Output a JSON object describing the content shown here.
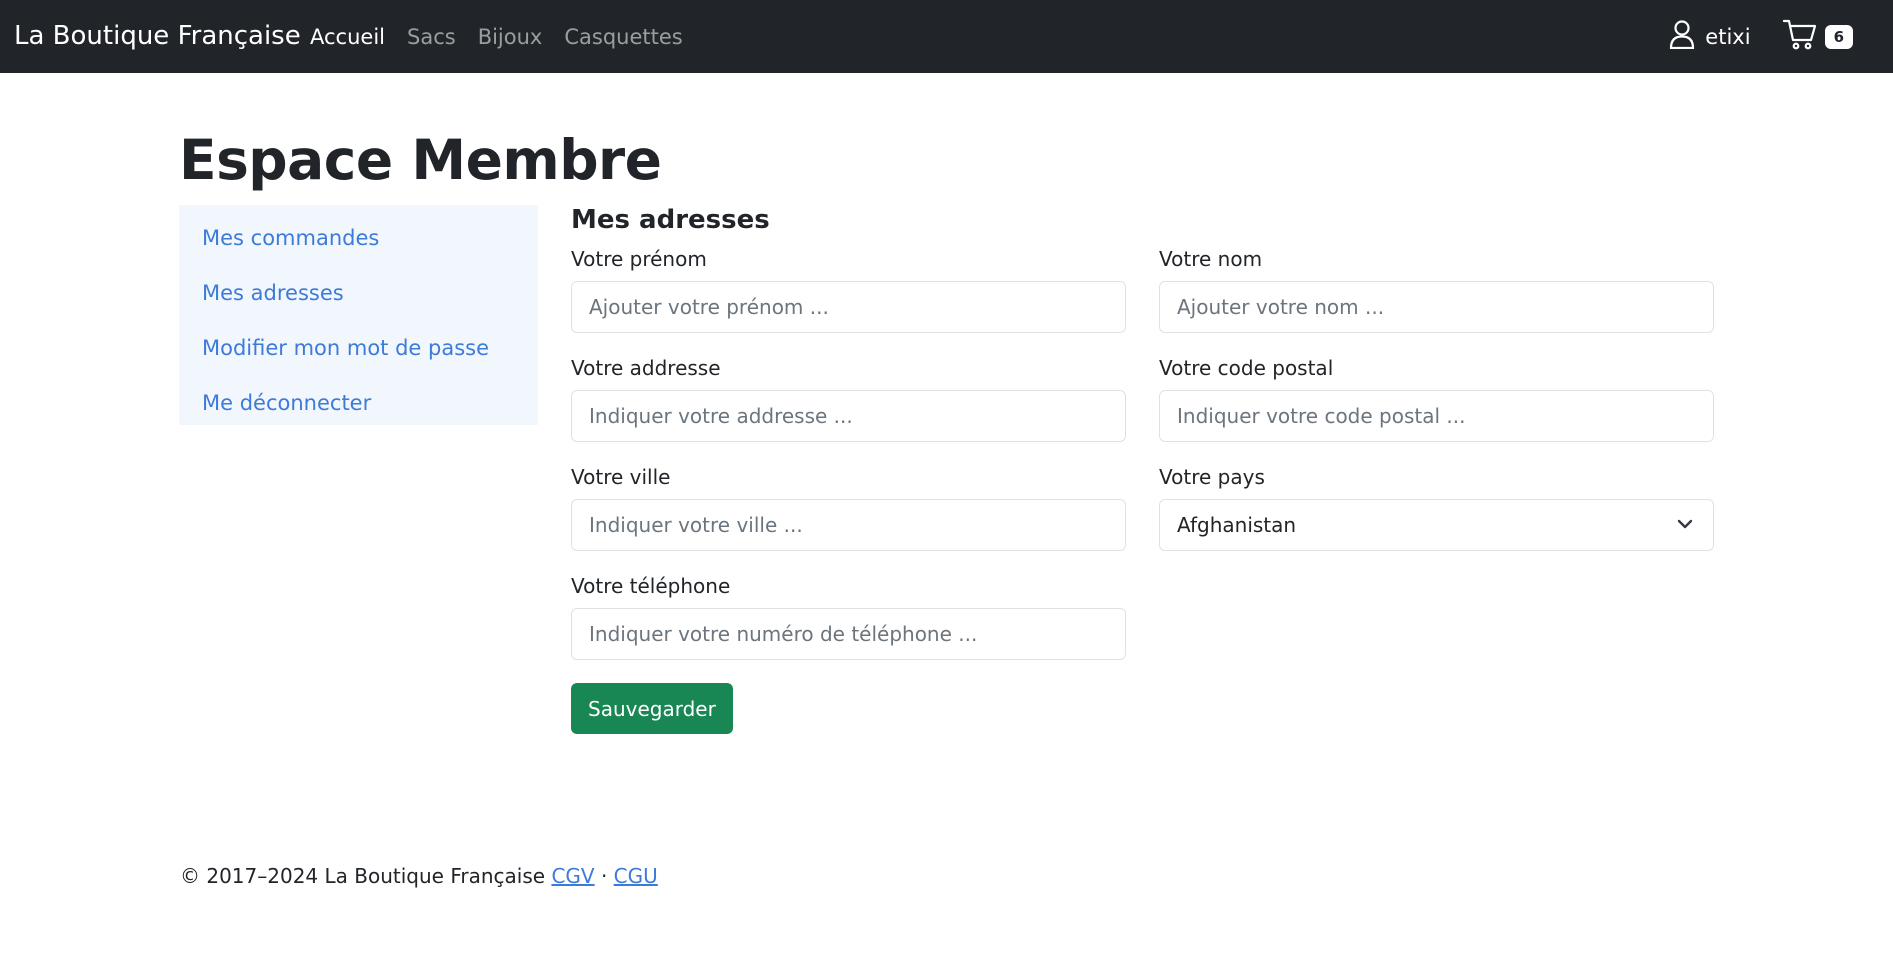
{
  "navbar": {
    "brand": "La Boutique Française",
    "links": [
      {
        "label": "Accueil",
        "active": true
      },
      {
        "label": "Sacs",
        "active": false
      },
      {
        "label": "Bijoux",
        "active": false
      },
      {
        "label": "Casquettes",
        "active": false
      }
    ],
    "username": "etixi",
    "cart_count": "6"
  },
  "page": {
    "title": "Espace Membre"
  },
  "sidebar": {
    "items": [
      {
        "label": "Mes commandes"
      },
      {
        "label": "Mes adresses"
      },
      {
        "label": "Modifier mon mot de passe"
      },
      {
        "label": "Me déconnecter"
      }
    ]
  },
  "form": {
    "title": "Mes adresses",
    "firstname": {
      "label": "Votre prénom",
      "placeholder": "Ajouter votre prénom ..."
    },
    "lastname": {
      "label": "Votre nom",
      "placeholder": "Ajouter votre nom ..."
    },
    "address": {
      "label": "Votre addresse",
      "placeholder": "Indiquer votre addresse ..."
    },
    "postal": {
      "label": "Votre code postal",
      "placeholder": "Indiquer votre code postal ..."
    },
    "city": {
      "label": "Votre ville",
      "placeholder": "Indiquer votre ville ..."
    },
    "country": {
      "label": "Votre pays",
      "value": "Afghanistan"
    },
    "phone": {
      "label": "Votre téléphone",
      "placeholder": "Indiquer votre numéro de téléphone ..."
    },
    "save_label": "Sauvegarder"
  },
  "footer": {
    "copyright": "© 2017–2024 La Boutique Française",
    "cgv": "CGV",
    "separator": "·",
    "cgu": "CGU"
  },
  "colors": {
    "navbar_bg": "#212529",
    "link": "#3d7bd8",
    "sidebar_bg": "#f2f6fd",
    "save_button": "#198754"
  }
}
